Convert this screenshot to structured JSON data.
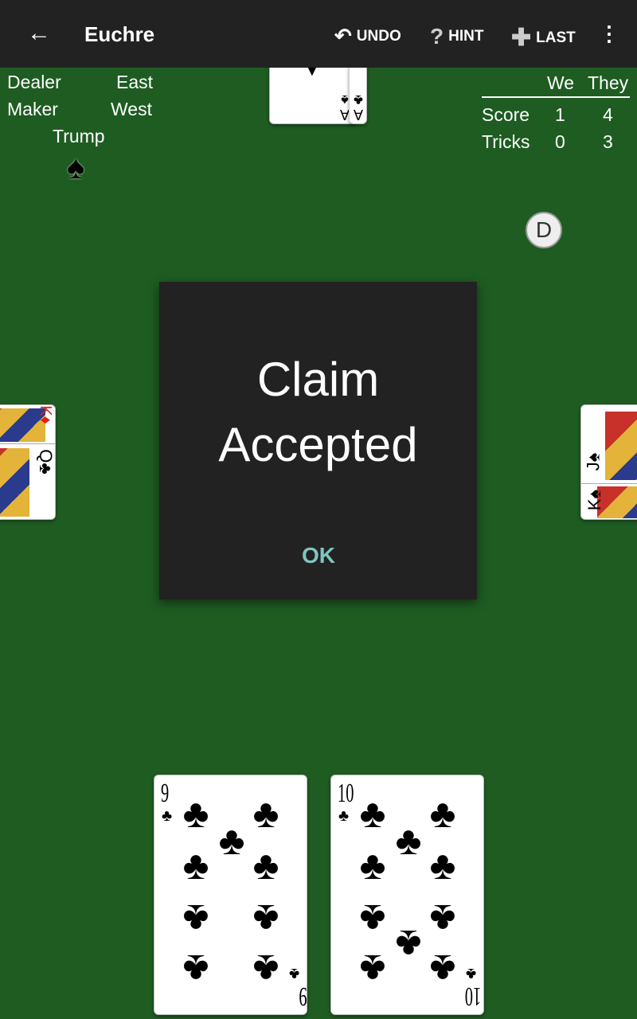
{
  "topbar": {
    "title": "Euchre",
    "back_icon": "arrow-left-icon",
    "undo": "UNDO",
    "hint": "HINT",
    "last": "LAST",
    "menu_icon": "more-vert-icon"
  },
  "info": {
    "dealer_label": "Dealer",
    "dealer": "East",
    "maker_label": "Maker",
    "maker": "West",
    "trump_label": "Trump",
    "trump_suit": "♠"
  },
  "score": {
    "we": "We",
    "they": "They",
    "score_label": "Score",
    "score_we": "1",
    "score_they": "4",
    "tricks_label": "Tricks",
    "tricks_we": "0",
    "tricks_they": "3"
  },
  "dealer_badge": "D",
  "dialog": {
    "line1": "Claim",
    "line2": "Accepted",
    "ok": "OK"
  },
  "north_cards": [
    {
      "rank": "A",
      "suit": "♠"
    },
    {
      "rank": "A",
      "suit": "♣"
    }
  ],
  "west_cards": [
    {
      "rank": "K",
      "suit": "♦"
    },
    {
      "rank": "Q",
      "suit": "♣"
    }
  ],
  "east_cards": [
    {
      "rank": "J",
      "suit": "♠"
    },
    {
      "rank": "K",
      "suit": "♠"
    }
  ],
  "hand": [
    {
      "rank": "9",
      "suit": "♣"
    },
    {
      "rank": "10",
      "suit": "♣"
    }
  ],
  "colors": {
    "felt": "#1e5c22",
    "bar": "#222222",
    "accent": "#7fc6c0",
    "red_suit": "#e0201a"
  }
}
